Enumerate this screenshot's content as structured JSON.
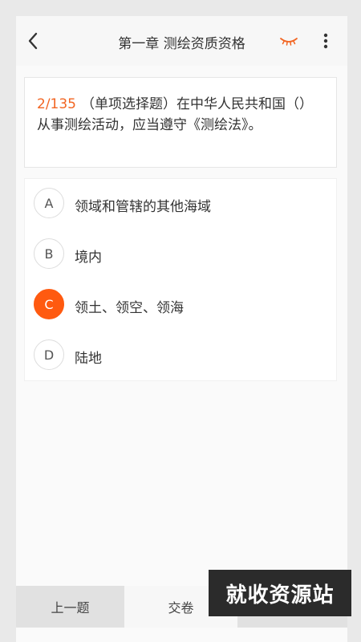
{
  "header": {
    "title": "第一章 测绘资质资格",
    "back_icon": "chevron-left-icon",
    "eye_icon": "closed-eye-icon",
    "more_icon": "more-vertical-icon",
    "accent_color": "#f26522"
  },
  "question": {
    "counter": "2/135",
    "text": "（单项选择题）在中华人民共和国（）从事测绘活动，应当遵守《测绘法》。"
  },
  "options": [
    {
      "letter": "A",
      "label": "领域和管辖的其他海域",
      "selected": false
    },
    {
      "letter": "B",
      "label": "境内",
      "selected": false
    },
    {
      "letter": "C",
      "label": "领土、领空、领海",
      "selected": true
    },
    {
      "letter": "D",
      "label": "陆地",
      "selected": false
    }
  ],
  "bottom": {
    "prev_label": "上一题",
    "submit_label": "交卷"
  },
  "watermark": {
    "text": "就收资源站"
  }
}
